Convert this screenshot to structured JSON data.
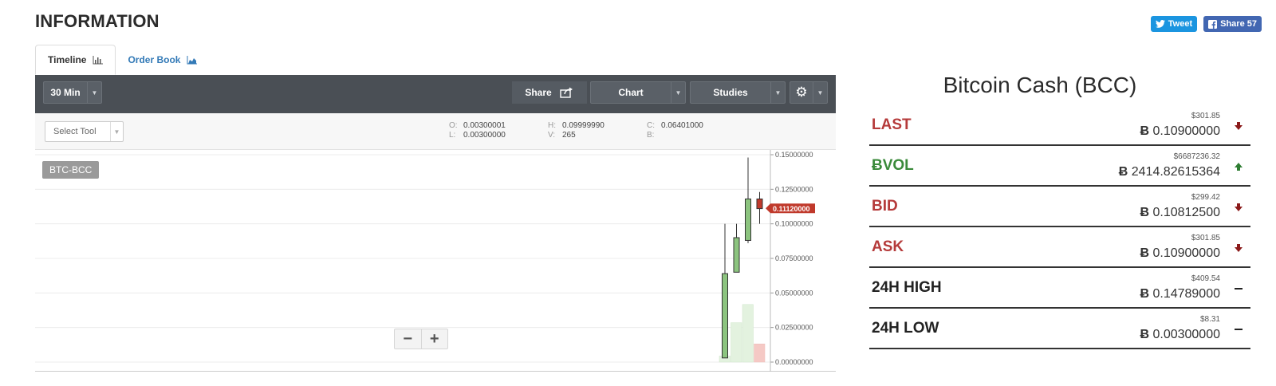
{
  "page": {
    "title": "INFORMATION"
  },
  "social": {
    "tweet": "Tweet",
    "share": "Share 57"
  },
  "tabs": [
    {
      "label": "Timeline",
      "icon": "bar-chart-icon",
      "active": true
    },
    {
      "label": "Order Book",
      "icon": "area-chart-icon",
      "active": false
    }
  ],
  "toolbar": {
    "interval": "30 Min",
    "share": "Share",
    "chart": "Chart",
    "studies": "Studies"
  },
  "subbar": {
    "select_tool": "Select Tool",
    "ohlc": {
      "o": "0.00300001",
      "h": "0.09999990",
      "c": "0.06401000",
      "l": "0.00300000",
      "v": "265",
      "b": ""
    },
    "keys": {
      "o": "O:",
      "h": "H:",
      "c": "C:",
      "l": "L:",
      "v": "V:",
      "b": "B:"
    }
  },
  "chart": {
    "symbol": "BTC-BCC",
    "zoom_out": "−",
    "zoom_in": "+"
  },
  "chart_data": {
    "type": "candlestick",
    "title": "",
    "ylim": [
      0,
      0.15
    ],
    "y_ticks": [
      "0.15000000",
      "0.12500000",
      "0.10000000",
      "0.07500000",
      "0.05000000",
      "0.02500000",
      "0.00000000"
    ],
    "y_tick_values": [
      0.15,
      0.125,
      0.1,
      0.075,
      0.05,
      0.025,
      0
    ],
    "last_price_label": "0.11120000",
    "last_price": 0.1112,
    "candles": [
      {
        "open": 0.003,
        "high": 0.0999999,
        "low": 0.003,
        "close": 0.064,
        "dir": "up"
      },
      {
        "open": 0.065,
        "high": 0.1,
        "low": 0.065,
        "close": 0.09,
        "dir": "up"
      },
      {
        "open": 0.088,
        "high": 0.148,
        "low": 0.086,
        "close": 0.118,
        "dir": "up"
      },
      {
        "open": 0.118,
        "high": 0.123,
        "low": 0.1,
        "close": 0.111,
        "dir": "down"
      }
    ],
    "volume_scale": 0.04,
    "volume": [
      {
        "v": 0.004,
        "dir": "up"
      },
      {
        "v": 0.026,
        "dir": "up"
      },
      {
        "v": 0.038,
        "dir": "up"
      },
      {
        "v": 0.012,
        "dir": "down"
      }
    ],
    "colors": {
      "up": "#8cc47f",
      "down": "#c0392b",
      "up_volume": "#e3f2df",
      "down_volume": "#f5c9c5"
    }
  },
  "info": {
    "title": "Bitcoin Cash (BCC)",
    "btc_symbol": "Ƀ",
    "rows": [
      {
        "label": "LAST",
        "usd": "$301.85",
        "btc": "0.10900000",
        "label_color": "#b53a3a",
        "trend": "down"
      },
      {
        "label": "VOL",
        "label_prefix": "Ƀ",
        "usd": "$6687236.32",
        "btc": "2414.82615364",
        "label_color": "#3a8a3a",
        "trend": "up"
      },
      {
        "label": "BID",
        "usd": "$299.42",
        "btc": "0.10812500",
        "label_color": "#b53a3a",
        "trend": "down"
      },
      {
        "label": "ASK",
        "usd": "$301.85",
        "btc": "0.10900000",
        "label_color": "#b53a3a",
        "trend": "down"
      },
      {
        "label": "24H HIGH",
        "usd": "$409.54",
        "btc": "0.14789000",
        "label_color": "#222222",
        "trend": "flat"
      },
      {
        "label": "24H LOW",
        "usd": "$8.31",
        "btc": "0.00300000",
        "label_color": "#222222",
        "trend": "flat"
      }
    ]
  }
}
